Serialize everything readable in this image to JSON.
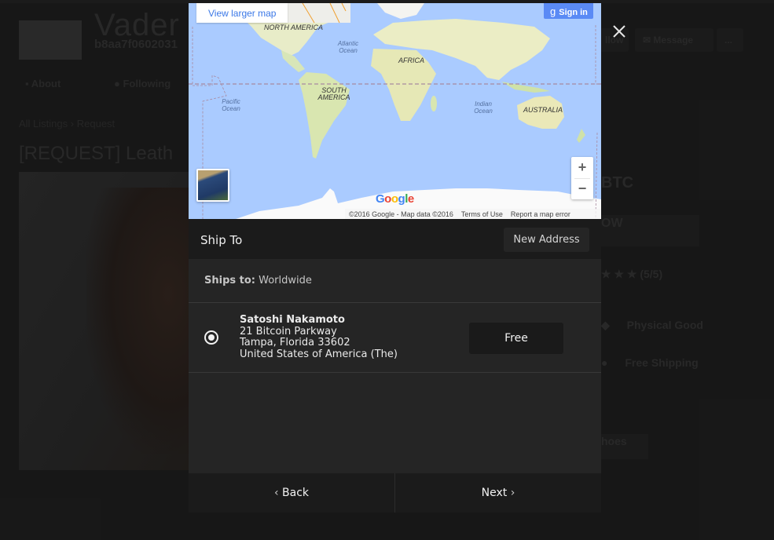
{
  "background": {
    "store_name": "Vader Moon",
    "store_guid": "b8aa7f0602031",
    "tabs": [
      {
        "label": "About",
        "icon": "chat-icon"
      },
      {
        "label": "Following",
        "icon": "person-icon"
      }
    ],
    "header_buttons": [
      {
        "label": "llow"
      },
      {
        "label": "Message",
        "icon": "message-icon"
      },
      {
        "label": "..."
      }
    ],
    "breadcrumb": [
      "All Listings",
      "Request"
    ],
    "breadcrumb_separator": "›",
    "listing_title": "[REQUEST] Leath",
    "price_suffix": "BTC",
    "buy_label": "OW",
    "rating_stars": 5,
    "rating_max": 5,
    "rating_label": "(5/5)",
    "attributes": [
      {
        "label": "Physical Good",
        "icon": "tag-icon"
      },
      {
        "label": "Free Shipping",
        "icon": "box-icon"
      }
    ],
    "tag": "hoes"
  },
  "modal": {
    "close_icon": "close-icon",
    "map": {
      "view_larger_label": "View larger map",
      "sign_in_label": "Sign in",
      "sign_in_icon": "google-g-icon",
      "continent_labels": [
        "NORTH AMERICA",
        "SOUTH AMERICA",
        "AFRICA",
        "AUSTRALIA"
      ],
      "ocean_labels": [
        "Atlantic Ocean",
        "Pacific Ocean",
        "Indian Ocean"
      ],
      "zoom_in": "+",
      "zoom_out": "−",
      "logo": "Google",
      "attribution": "©2016 Google - Map data ©2016",
      "terms_label": "Terms of Use",
      "report_label": "Report a map error"
    },
    "ship_to": {
      "title": "Ship To",
      "new_address_label": "New Address",
      "ships_to_prefix": "Ships to:",
      "ships_to_value": "Worldwide"
    },
    "addresses": [
      {
        "selected": true,
        "name": "Satoshi Nakamoto",
        "street": "21 Bitcoin Parkway",
        "city_line": "Tampa, Florida 33602",
        "country": "United States of America (The)",
        "shipping_price": "Free"
      }
    ],
    "footer": {
      "back_label": "Back",
      "next_label": "Next"
    }
  }
}
